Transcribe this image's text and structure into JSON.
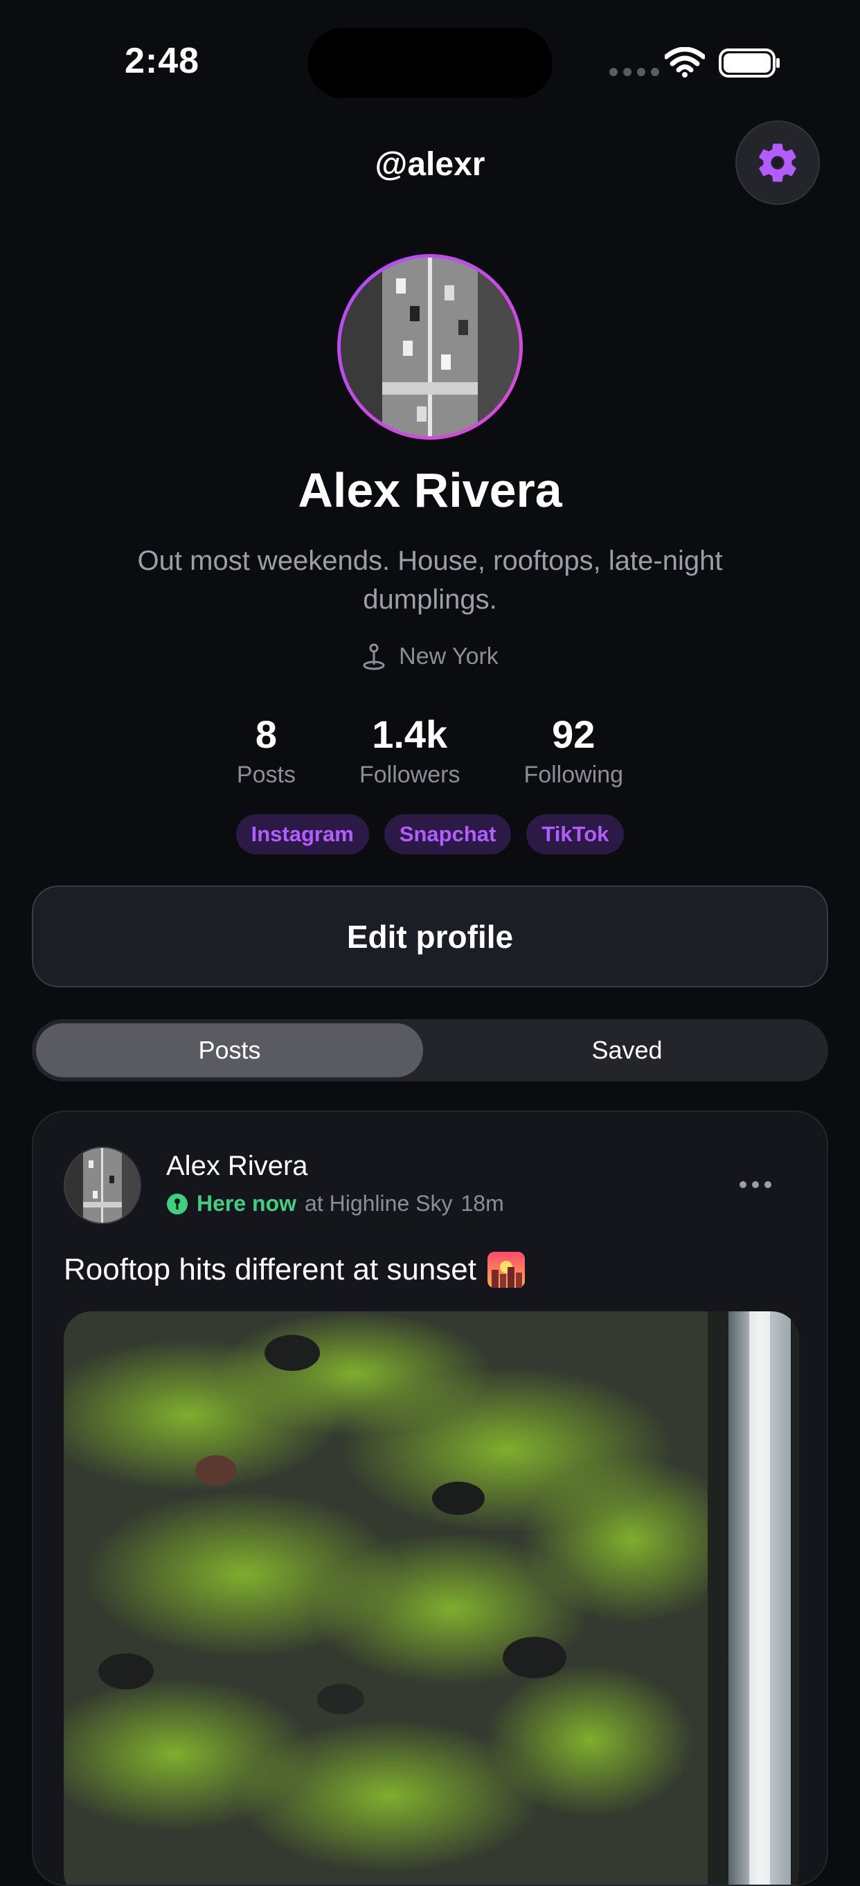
{
  "status_bar": {
    "time": "2:48"
  },
  "header": {
    "handle": "@alexr"
  },
  "profile": {
    "name": "Alex Rivera",
    "bio": "Out most weekends. House, rooftops, late-night dumplings.",
    "location": "New York"
  },
  "stats": [
    {
      "value": "8",
      "label": "Posts"
    },
    {
      "value": "1.4k",
      "label": "Followers"
    },
    {
      "value": "92",
      "label": "Following"
    }
  ],
  "socials": [
    "Instagram",
    "Snapchat",
    "TikTok"
  ],
  "edit_button": "Edit profile",
  "tabs": {
    "posts": "Posts",
    "saved": "Saved"
  },
  "post": {
    "author": "Alex Rivera",
    "status": "Here now",
    "venue": "at Highline Sky",
    "time_ago": "18m",
    "caption": "Rooftop hits different at sunset"
  },
  "colors": {
    "accent": "#b35cff",
    "here_now": "#3fd07f",
    "background": "#0b0c10",
    "card": "#15161c"
  }
}
